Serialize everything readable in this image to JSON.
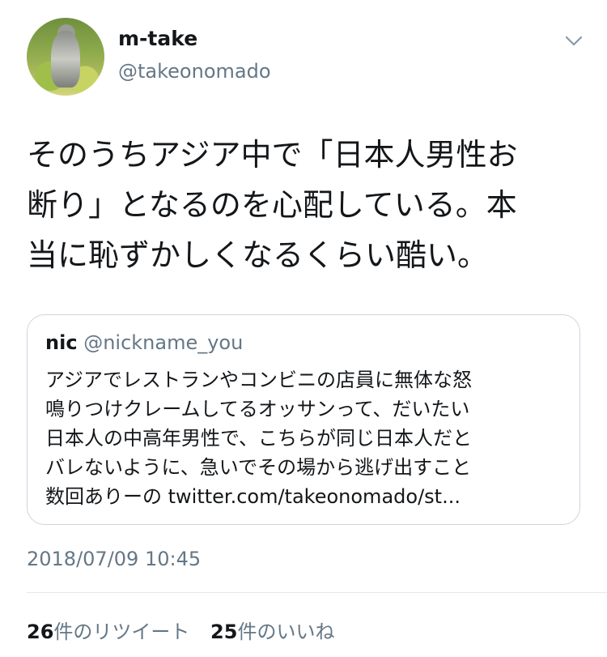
{
  "author": {
    "name": "m-take",
    "handle": "@takeonomado",
    "avatar_icon": "statue-avatar"
  },
  "menu_icon": "chevron-down-icon",
  "tweet": {
    "lines": [
      "そのうちアジア中で「日本人男性お",
      "断り」となるのを心配している。本",
      "当に恥ずかしくなるくらい酷い。"
    ]
  },
  "quoted_tweet": {
    "name": "nic",
    "handle": "@nickname_you",
    "lines": [
      "アジアでレストランやコンビニの店員に無体な怒",
      "鳴りつけクレームしてるオッサンって、だいたい",
      "日本人の中高年男性で、こちらが同じ日本人だと",
      "バレないように、急いでその場から逃げ出すこと",
      "数回ありーの twitter.com/takeonomado/st..."
    ]
  },
  "timestamp": "2018/07/09 10:45",
  "stats": {
    "retweets_count": "26",
    "retweets_label": "件のリツイート",
    "likes_count": "25",
    "likes_label": "件のいいね"
  },
  "colors": {
    "text": "#14171a",
    "secondary": "#657786",
    "border": "#ccd6dd",
    "divider": "#e1e8ed"
  }
}
